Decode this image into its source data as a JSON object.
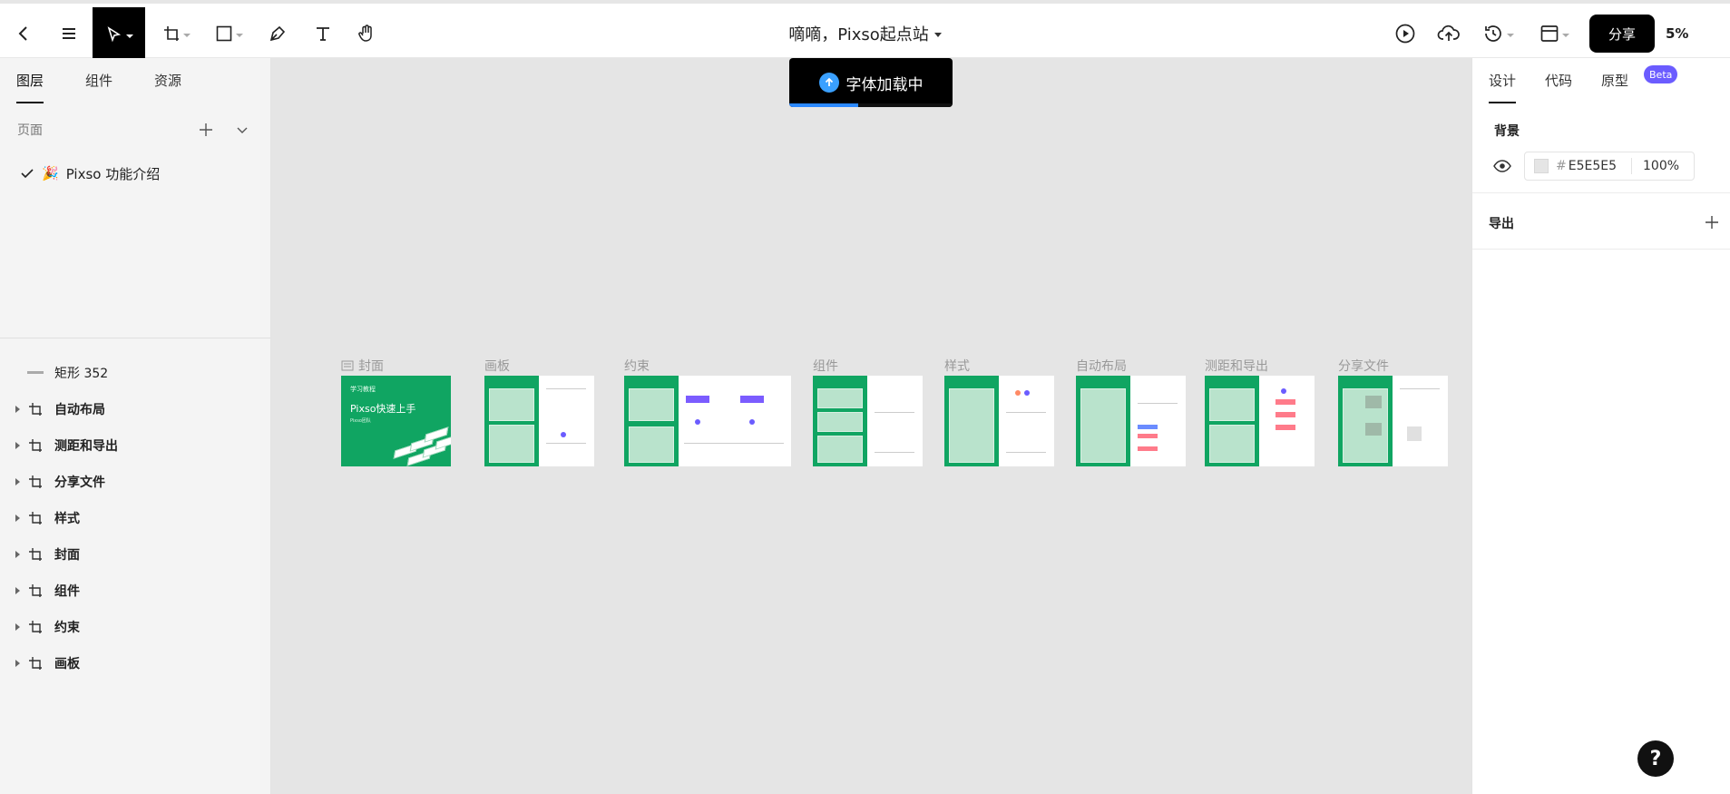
{
  "doc": {
    "title": "嘀嘀，Pixso起点站"
  },
  "toolbar": {
    "share_label": "分享",
    "zoom": "5%"
  },
  "toast": {
    "label": "字体加载中",
    "progress": 0.42
  },
  "left": {
    "tabs": [
      "图层",
      "组件",
      "资源"
    ],
    "pages_label": "页面",
    "page": {
      "emoji": "🎉",
      "name": "Pixso 功能介绍"
    },
    "layers": [
      {
        "name": "矩形 352",
        "kind": "rect"
      },
      {
        "name": "自动布局",
        "kind": "frame"
      },
      {
        "name": "测距和导出",
        "kind": "frame"
      },
      {
        "name": "分享文件",
        "kind": "frame"
      },
      {
        "name": "样式",
        "kind": "frame"
      },
      {
        "name": "封面",
        "kind": "frame"
      },
      {
        "name": "组件",
        "kind": "frame"
      },
      {
        "name": "约束",
        "kind": "frame"
      },
      {
        "name": "画板",
        "kind": "frame"
      }
    ]
  },
  "canvas": {
    "frames": [
      {
        "label": "封面",
        "cover_small": "学习教程",
        "cover_title": "Pixso快速上手",
        "cover_sub": "Pixso团队"
      },
      {
        "label": "画板"
      },
      {
        "label": "约束"
      },
      {
        "label": "组件"
      },
      {
        "label": "样式"
      },
      {
        "label": "自动布局"
      },
      {
        "label": "测距和导出"
      },
      {
        "label": "分享文件"
      }
    ]
  },
  "right": {
    "tabs": [
      "设计",
      "代码",
      "原型"
    ],
    "beta": "Beta",
    "background_label": "背景",
    "bg_hex": "E5E5E5",
    "bg_opacity": "100%",
    "export_label": "导出"
  },
  "colors": {
    "accent": "#10a562",
    "toolbar_active": "#000000",
    "beta": "#6b5cff"
  }
}
